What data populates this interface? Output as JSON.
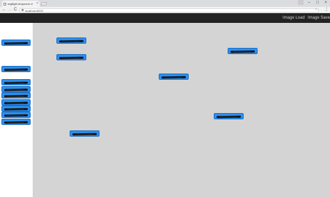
{
  "browser": {
    "tab_title": "mgflight dropzone vi",
    "tab_close": "×",
    "url": "localhost:8000",
    "window_controls": {
      "minimize": "–",
      "maximize": "□",
      "close": "×"
    },
    "nav": {
      "back": "←",
      "forward": "→",
      "reload": "C",
      "star": "☆",
      "menu": "⋮"
    }
  },
  "header": {
    "buttons": [
      {
        "label": "Image Load"
      },
      {
        "label": "Image Save"
      }
    ]
  },
  "sidebar": {
    "items": [
      {
        "label": ""
      },
      {
        "label": ""
      },
      {
        "label": ""
      },
      {
        "label": ""
      },
      {
        "label": ""
      },
      {
        "label": ""
      },
      {
        "label": ""
      },
      {
        "label": ""
      },
      {
        "label": ""
      },
      {
        "label": ""
      }
    ]
  },
  "canvas": {
    "nodes": [
      {
        "label": ""
      },
      {
        "label": ""
      },
      {
        "label": ""
      },
      {
        "label": ""
      },
      {
        "label": ""
      },
      {
        "label": ""
      }
    ]
  },
  "colors": {
    "node_fill": "#2b8ff0",
    "canvas_bg": "#d4d4d4",
    "header_bg": "#222222"
  }
}
